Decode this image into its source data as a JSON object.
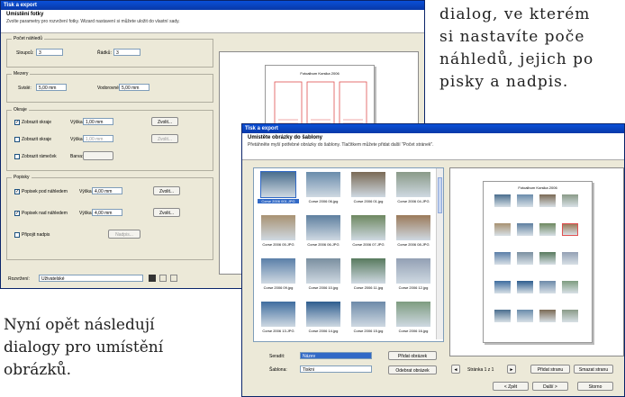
{
  "article": {
    "top_right_lines": [
      "dialog, ve kterém",
      "si nastavíte poče",
      "náhledů, jejich po",
      "pisky a nadpis."
    ],
    "bottom_left_lines": [
      "Nyní opět následují",
      "dialogy pro umístění",
      "obrázků."
    ]
  },
  "dialog_layout": {
    "title": "Tisk a export",
    "header_title": "Umístění fotky",
    "header_subtitle": "Zvolte parametry pro rozvržení fotky. Wizard nastavení si můžete uložit do vlastní sady.",
    "group_pocet": "Počet náhledů",
    "sloupcu_label": "Sloupců:",
    "sloupcu_value": "3",
    "radku_label": "Řádků:",
    "radku_value": "3",
    "group_mezery": "Mezery",
    "svisle_label": "Svislé:",
    "svisle_value": "5,00 mm",
    "vodorovne_label": "Vodorovné:",
    "vodorovne_value": "5,00 mm",
    "group_okraje": "Okraje",
    "check_zobrazit_okraje": "Zobrazit okraje",
    "check_zobrazit_okraje2": "Zobrazit okraje",
    "check_zobrazit_ramecek": "Zobrazit rámeček",
    "vyska_label": "Výška:",
    "vyska_value": "1,00 mm",
    "barva_label": "Barva:",
    "zvolit_button": "Zvolit...",
    "group_popisky": "Popisky",
    "check_popisek_pod": "Popisek pod náhledem",
    "check_popisek_nad": "Popisek nad náhledem",
    "popisek_vyska_value": "4,00 mm",
    "check_nadpis": "Připojit nadpis",
    "nadpis_button": "Nadpis...",
    "rozvrzeni_label": "Rozvržení:",
    "rozvrzeni_value": "Uživatelské",
    "preview_title": "Fotoalbum Korsika 2006",
    "preview_grid_cols": 3,
    "preview_grid_rows": 3,
    "accent_color": "#e05050"
  },
  "dialog_select": {
    "title": "Tisk a export",
    "header_title": "Umístěte obrázky do šablony",
    "header_subtitle": "Přetáhněte myší potřebné obrázky do šablony. Tlačítkem můžete přidat další \"Počet stránek\".",
    "thumbnails": [
      "Corse 2006 001.JPG",
      "Corse 2006 06.jpg",
      "Corse 2006 01.jpg",
      "Corse 2006 04.JPG",
      "Corse 2006 05.JPG",
      "Corse 2006 06.JPG",
      "Corse 2006 07.JPG",
      "Corse 2006 08.JPG",
      "Corse 2006 09.jpg",
      "Corse 2006 10.jpg",
      "Corse 2006 11.jpg",
      "Corse 2006 12.jpg",
      "Corse 2006 13.JPG",
      "Corse 2006 14.jpg",
      "Corse 2006 15.jpg",
      "Corse 2006 16.jpg"
    ],
    "thumb_colors": [
      "#4a6e8e",
      "#6a8cab",
      "#7b6a55",
      "#8a9a88",
      "#a89272",
      "#5e7f9f",
      "#6e8860",
      "#9b7a5a",
      "#5a7fa8",
      "#7a8fa0",
      "#587a5e",
      "#93a0b4",
      "#3f6d9f",
      "#2e5d8f",
      "#6d8aa9",
      "#7e9c80"
    ],
    "razeni_label": "Seradit:",
    "razeni_value": "Název",
    "sablona_label": "Šablona:",
    "sablona_value": "Tiskni",
    "pridat_button": "Přidat obrázek",
    "odebrat_button": "Odebrat obrázek",
    "page_text": "Stránka 1 z 1",
    "pridat_stranu_button": "Přidat stranu",
    "smazat_stranu_button": "Smazat stranu",
    "back_button": "< Zpět",
    "next_button": "Další >",
    "cancel_button": "Storno",
    "preview_title": "Fotoalbum Korsika 2006"
  }
}
